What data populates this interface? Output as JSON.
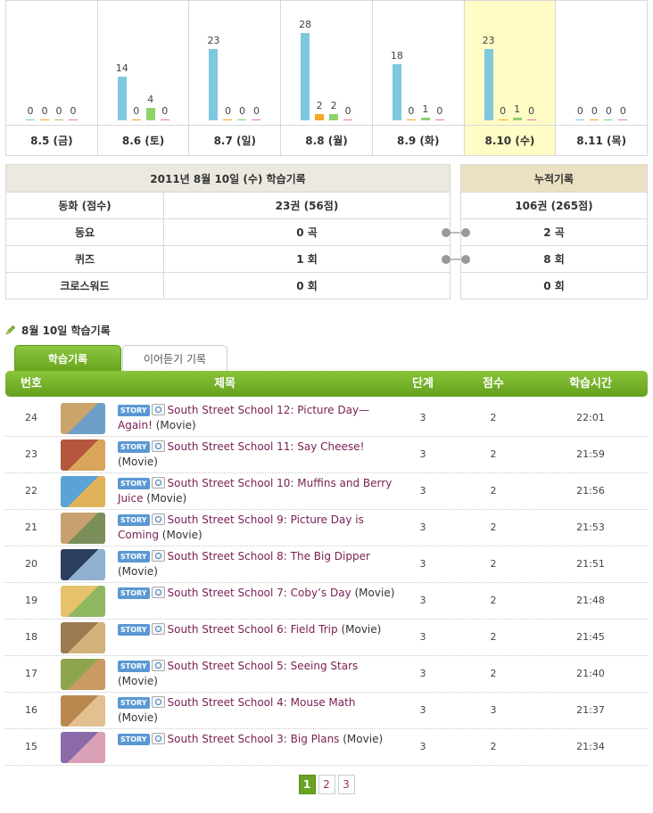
{
  "week": {
    "selected_index": 5,
    "colors": [
      "#7ec9df",
      "#f5a623",
      "#8fd16b",
      "#e87aa7"
    ],
    "days": [
      {
        "label": "8.5 (금)",
        "values": [
          0,
          0,
          0,
          0
        ]
      },
      {
        "label": "8.6 (토)",
        "values": [
          14,
          0,
          4,
          0
        ]
      },
      {
        "label": "8.7 (일)",
        "values": [
          23,
          0,
          0,
          0
        ]
      },
      {
        "label": "8.8 (월)",
        "values": [
          28,
          2,
          2,
          0
        ]
      },
      {
        "label": "8.9 (화)",
        "values": [
          18,
          0,
          1,
          0
        ]
      },
      {
        "label": "8.10 (수)",
        "values": [
          23,
          0,
          1,
          0
        ]
      },
      {
        "label": "8.11 (목)",
        "values": [
          0,
          0,
          0,
          0
        ]
      }
    ]
  },
  "today": {
    "title": "2011년 8월 10일 (수) 학습기록",
    "rows": [
      {
        "label": "동화 (점수)",
        "value": "23권 (56점)"
      },
      {
        "label": "동요",
        "value": "0 곡"
      },
      {
        "label": "퀴즈",
        "value": "1 회"
      },
      {
        "label": "크로스워드",
        "value": "0 회"
      }
    ]
  },
  "total": {
    "title": "누적기록",
    "values": [
      "106권 (265점)",
      "2 곡",
      "8 회",
      "0 회"
    ]
  },
  "section_title": "8월 10일 학습기록",
  "tabs": {
    "study": "학습기록",
    "listen": "이어듣기 기록"
  },
  "list": {
    "headers": {
      "num": "번호",
      "title": "제목",
      "level": "단계",
      "score": "점수",
      "time": "학습시간"
    },
    "badge": "STORY",
    "rows": [
      {
        "num": "24",
        "title": "South Street School 12: Picture Day—Again!",
        "suffix": "(Movie)",
        "level": "3",
        "score": "2",
        "time": "22:01",
        "thumb": [
          "#c9a46b",
          "#6e9fc9"
        ]
      },
      {
        "num": "23",
        "title": "South Street School 11: Say Cheese!",
        "suffix": "(Movie)",
        "level": "3",
        "score": "2",
        "time": "21:59",
        "thumb": [
          "#b5563d",
          "#d9a55a"
        ]
      },
      {
        "num": "22",
        "title": "South Street School 10: Muffins and Berry Juice",
        "suffix": "(Movie)",
        "level": "3",
        "score": "2",
        "time": "21:56",
        "thumb": [
          "#5aa3d6",
          "#e0b25a"
        ]
      },
      {
        "num": "21",
        "title": "South Street School 9: Picture Day is Coming",
        "suffix": "(Movie)",
        "level": "3",
        "score": "2",
        "time": "21:53",
        "thumb": [
          "#c8a070",
          "#7a8f5a"
        ]
      },
      {
        "num": "20",
        "title": "South Street School 8: The Big Dipper",
        "suffix": "(Movie)",
        "level": "3",
        "score": "2",
        "time": "21:51",
        "thumb": [
          "#2c3f5e",
          "#8fb0d0"
        ]
      },
      {
        "num": "19",
        "title": "South Street School 7: Coby’s Day",
        "suffix": "(Movie)",
        "level": "3",
        "score": "2",
        "time": "21:48",
        "thumb": [
          "#e6c36a",
          "#8db860"
        ]
      },
      {
        "num": "18",
        "title": "South Street School 6: Field Trip",
        "suffix": "(Movie)",
        "level": "3",
        "score": "2",
        "time": "21:45",
        "thumb": [
          "#9c7a52",
          "#d2b27a"
        ]
      },
      {
        "num": "17",
        "title": "South Street School 5: Seeing Stars",
        "suffix": "(Movie)",
        "level": "3",
        "score": "2",
        "time": "21:40",
        "thumb": [
          "#8da64e",
          "#c99a62"
        ]
      },
      {
        "num": "16",
        "title": "South Street School 4: Mouse Math",
        "suffix": "(Movie)",
        "level": "3",
        "score": "3",
        "time": "21:37",
        "thumb": [
          "#b9884f",
          "#e3c090"
        ]
      },
      {
        "num": "15",
        "title": "South Street School 3: Big Plans",
        "suffix": "(Movie)",
        "level": "3",
        "score": "2",
        "time": "21:34",
        "thumb": [
          "#8a6aa8",
          "#d9a0b8"
        ]
      }
    ]
  },
  "pagination": {
    "pages": [
      "1",
      "2",
      "3"
    ],
    "current": 0
  }
}
